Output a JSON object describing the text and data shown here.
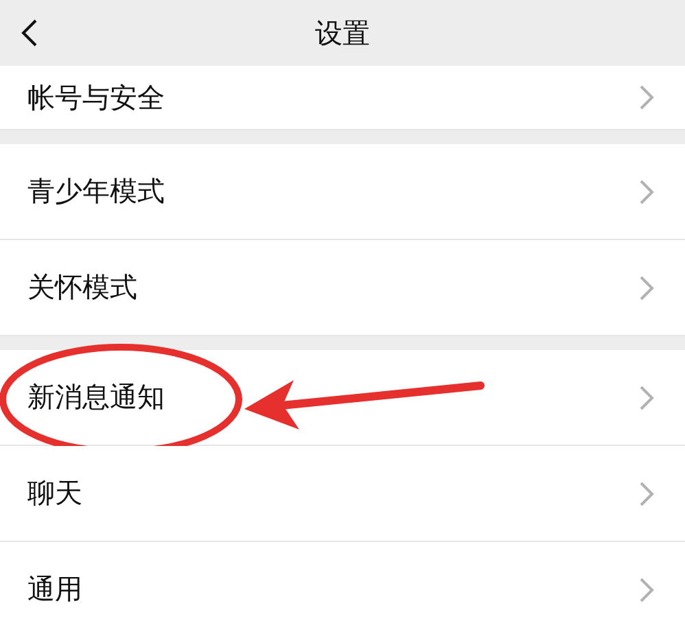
{
  "header": {
    "title": "设置"
  },
  "sections": [
    {
      "items": [
        {
          "label": "帐号与安全",
          "circled": false
        }
      ]
    },
    {
      "items": [
        {
          "label": "青少年模式",
          "circled": false
        },
        {
          "label": "关怀模式",
          "circled": false
        }
      ]
    },
    {
      "items": [
        {
          "label": "新消息通知",
          "circled": true
        },
        {
          "label": "聊天",
          "circled": false
        },
        {
          "label": "通用",
          "circled": false
        }
      ]
    }
  ]
}
